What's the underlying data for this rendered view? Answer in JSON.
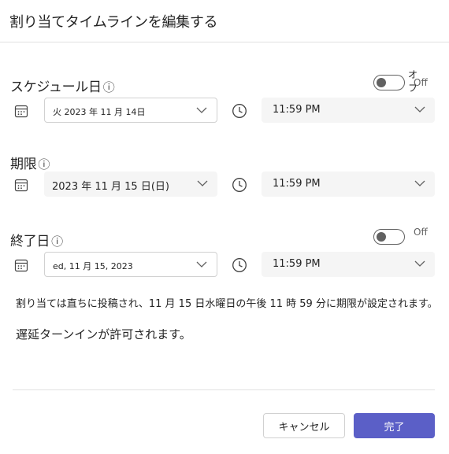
{
  "dialog": {
    "title": "割り当てタイムラインを編集する"
  },
  "schedule": {
    "label": "スケジュール日",
    "toggle_top_label": "オフ",
    "toggle_label": "Off",
    "date": "火 2023 年 11 月 14日",
    "time": "11:59 PM"
  },
  "due": {
    "label": "期限",
    "date": "2023 年 11 月 15 日(日)",
    "time": "11:59 PM"
  },
  "close": {
    "label": "終了日",
    "toggle_label": "Off",
    "date": "ed, 11 月 15, 2023",
    "time": "11:59 PM"
  },
  "notice": {
    "line1": "割り当ては直ちに投稿され、11 月 15 日水曜日の午後 11 時 59 分に期限が設定されます。",
    "line2": "遅延ターンインが許可されます。"
  },
  "footer": {
    "cancel_label": "キャンセル",
    "done_label": "完了"
  },
  "icons": {
    "calendar": "calendar-icon",
    "clock": "clock-icon",
    "chevron": "chevron-down-icon",
    "info": "info-icon"
  },
  "colors": {
    "accent": "#5b5fc7",
    "border": "#d1d1d1",
    "field_bg": "#f5f5f5"
  }
}
